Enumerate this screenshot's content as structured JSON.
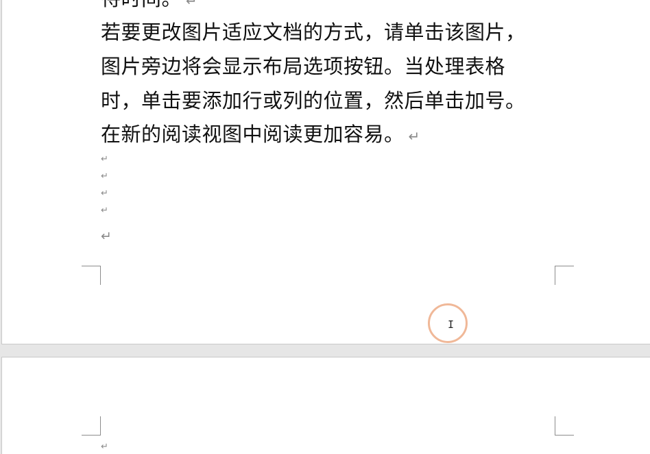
{
  "document": {
    "page1": {
      "lines": [
        {
          "text": "待时间。",
          "mark": "↵"
        },
        {
          "text": "若要更改图片适应文档的方式，请单击该图片，",
          "mark": ""
        },
        {
          "text": "图片旁边将会显示布局选项按钮。当处理表格",
          "mark": ""
        },
        {
          "text": "时，单击要添加行或列的位置，然后单击加号。",
          "mark": ""
        },
        {
          "text": "在新的阅读视图中阅读更加容易。",
          "mark": "↵"
        }
      ],
      "empty_paragraph_marks": [
        "↵",
        "↵",
        "↵",
        "↵",
        "↵"
      ]
    },
    "page2": {
      "empty_paragraph_marks": [
        "↵"
      ]
    }
  },
  "cursor": {
    "icon": "i-beam-cursor-icon",
    "glyph": "I",
    "highlight_color": "#f0b898"
  }
}
